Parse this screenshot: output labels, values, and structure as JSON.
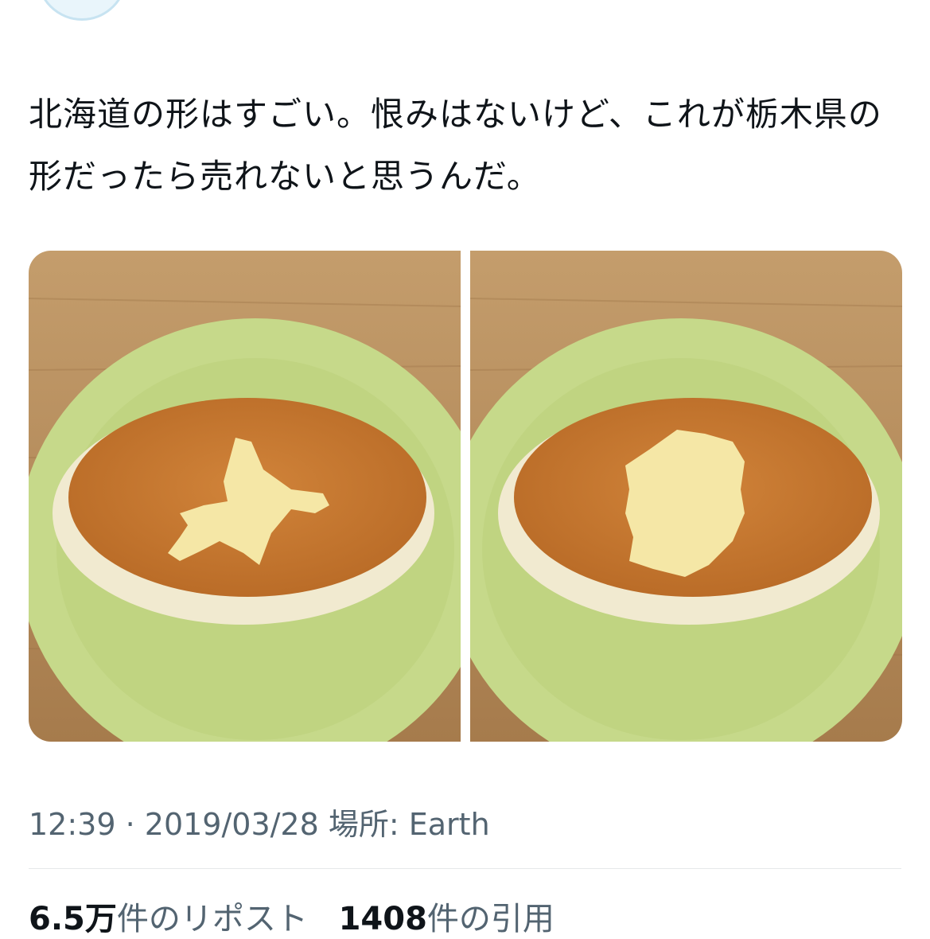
{
  "tweet": {
    "text": "北海道の形はすごい。恨みはないけど、これが栃木県の形だったら売れないと思うんだ。",
    "media": [
      {
        "icon": "photo-cake-hokkaido"
      },
      {
        "icon": "photo-cake-tochigi"
      }
    ],
    "meta": {
      "time": "12:39",
      "separator": " · ",
      "date": "2019/03/28",
      "location_label": " 場所: ",
      "location": "Earth"
    },
    "stats": {
      "reposts_count": "6.5万",
      "reposts_label": "件のリポスト",
      "quotes_count": "1408",
      "quotes_label": "件の引用"
    }
  },
  "colors": {
    "text": "#0f1419",
    "secondary": "#536471",
    "divider": "#e6e8ea",
    "plate": "#c6d98a",
    "cake": "#c7782f",
    "cream": "#f5e7a6",
    "wood": "#b48a5a"
  }
}
